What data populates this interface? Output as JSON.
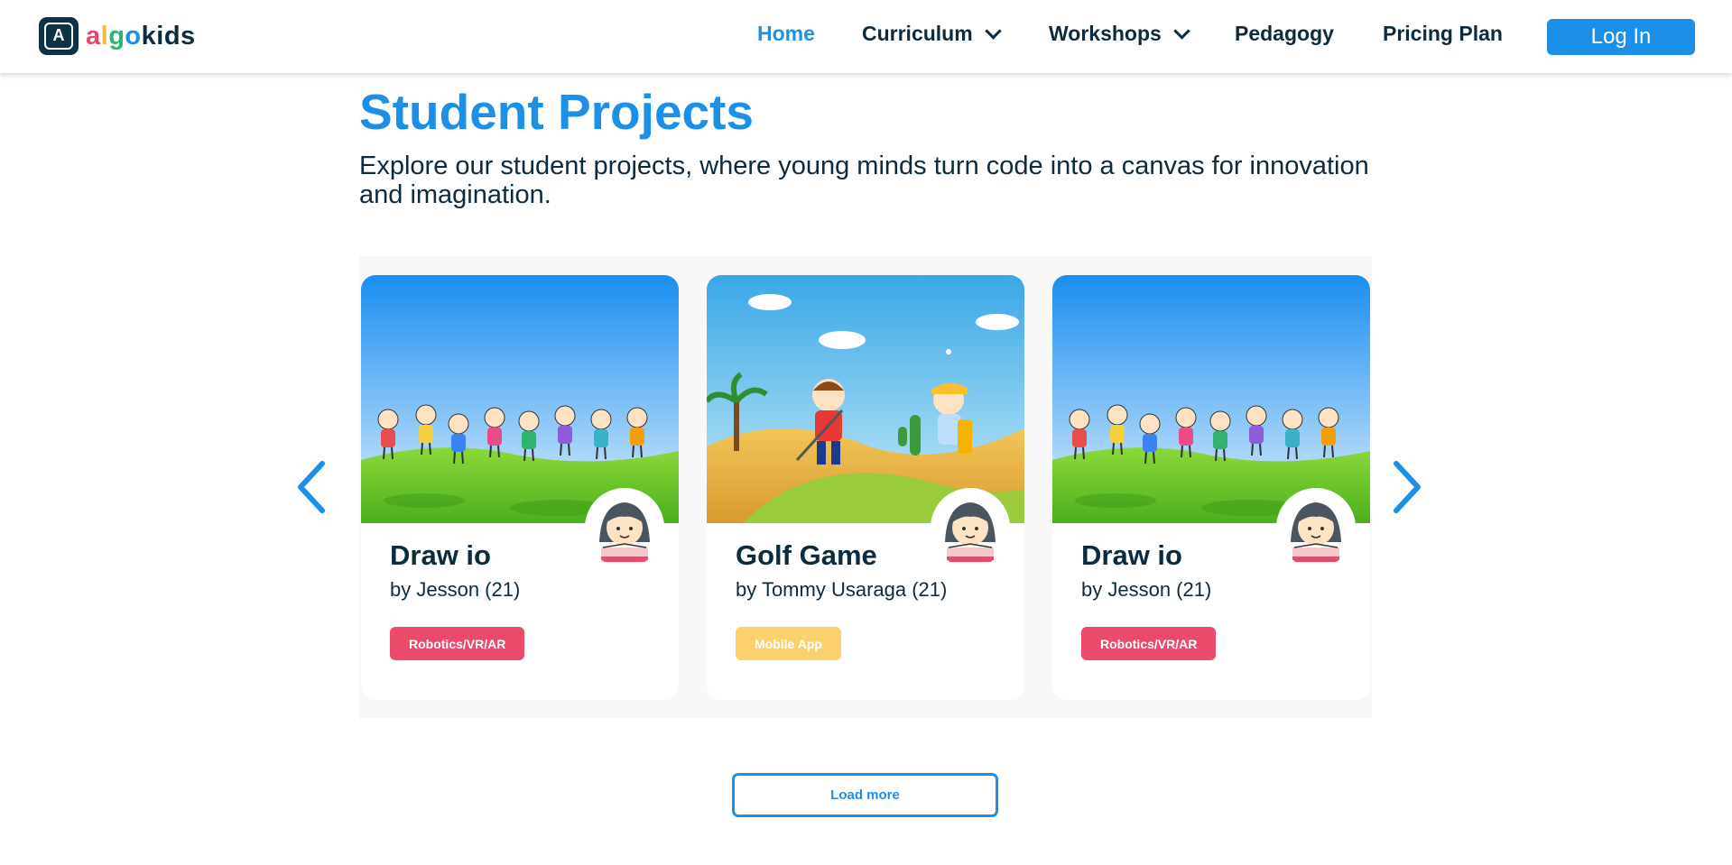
{
  "brand": {
    "logo_letter": "A",
    "name_letters": [
      {
        "ch": "a",
        "color": "#e8486d"
      },
      {
        "ch": "l",
        "color": "#f4b93a"
      },
      {
        "ch": "g",
        "color": "#2fb36d"
      },
      {
        "ch": "o",
        "color": "#1c8fe6"
      },
      {
        "ch": "kids",
        "color": "#0d2b3e"
      }
    ],
    "accent": "#1c8fe6",
    "text_dark": "#0d2b3e"
  },
  "nav": {
    "home": "Home",
    "curriculum": "Curriculum",
    "workshops": "Workshops",
    "pedagogy": "Pedagogy",
    "pricing": "Pricing Plan",
    "login": "Log In"
  },
  "hero": {
    "title": "Student Projects",
    "subtitle": "Explore our student projects, where young minds turn code into a canvas for innovation and imagination."
  },
  "projects": [
    {
      "title": "Draw io",
      "author": "by Jesson (21)",
      "tag": "Robotics/VR/AR",
      "tag_color": "#ec4a6b",
      "image": "kids-holding-hands-illustration"
    },
    {
      "title": "Golf Game",
      "author": "by Tommy Usaraga (21)",
      "tag": "Mobile App",
      "tag_color": "#fdd06e",
      "image": "kids-playing-golf-illustration"
    },
    {
      "title": "Draw io",
      "author": "by Jesson (21)",
      "tag": "Robotics/VR/AR",
      "tag_color": "#ec4a6b",
      "image": "kids-holding-hands-illustration"
    }
  ],
  "carousel": {
    "prev_icon": "chevron-left-icon",
    "next_icon": "chevron-right-icon"
  },
  "load_more": "Load more"
}
